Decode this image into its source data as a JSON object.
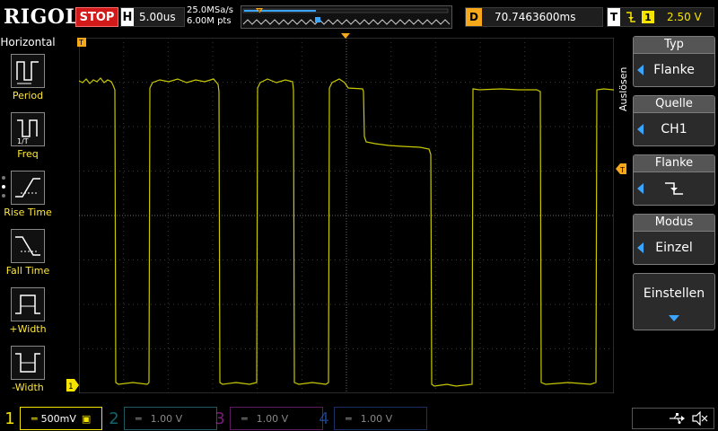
{
  "brand": "RIGOL",
  "run_state": "STOP",
  "horizontal": {
    "tag": "H",
    "timebase": "5.00us"
  },
  "sample": {
    "rate": "25.0MSa/s",
    "points": "6.00M pts"
  },
  "delay": {
    "tag": "D",
    "value": "70.7463600ms"
  },
  "trigger_status": {
    "tag": "T",
    "channel": "1",
    "level": "2.50 V"
  },
  "left_menu": {
    "title": "Horizontal",
    "items": [
      {
        "label": "Period",
        "icon": "period-icon"
      },
      {
        "label": "Freq",
        "icon": "freq-icon"
      },
      {
        "label": "Rise Time",
        "icon": "rise-time-icon"
      },
      {
        "label": "Fall Time",
        "icon": "fall-time-icon"
      },
      {
        "label": "+Width",
        "icon": "pos-width-icon"
      },
      {
        "label": "-Width",
        "icon": "neg-width-icon"
      }
    ]
  },
  "right_menu": {
    "side_label": "Auslösen",
    "typ": {
      "title": "Typ",
      "value": "Flanke"
    },
    "quelle": {
      "title": "Quelle",
      "value": "CH1"
    },
    "flanke": {
      "title": "Flanke",
      "icon": "falling-edge-icon"
    },
    "modus": {
      "title": "Modus",
      "value": "Einzel"
    },
    "einstellen": {
      "label": "Einstellen"
    }
  },
  "channels": [
    {
      "num": "1",
      "scale": "500mV",
      "color": "#f5e400"
    },
    {
      "num": "2",
      "scale": "1.00 V",
      "color": "#1fb8c4"
    },
    {
      "num": "3",
      "scale": "1.00 V",
      "color": "#d633d6"
    },
    {
      "num": "4",
      "scale": "1.00 V",
      "color": "#2f6cf0"
    }
  ],
  "colors": {
    "trace": "#c8c800",
    "trigger_marker": "#f7a81b",
    "accent": "#3aa6ff"
  }
}
